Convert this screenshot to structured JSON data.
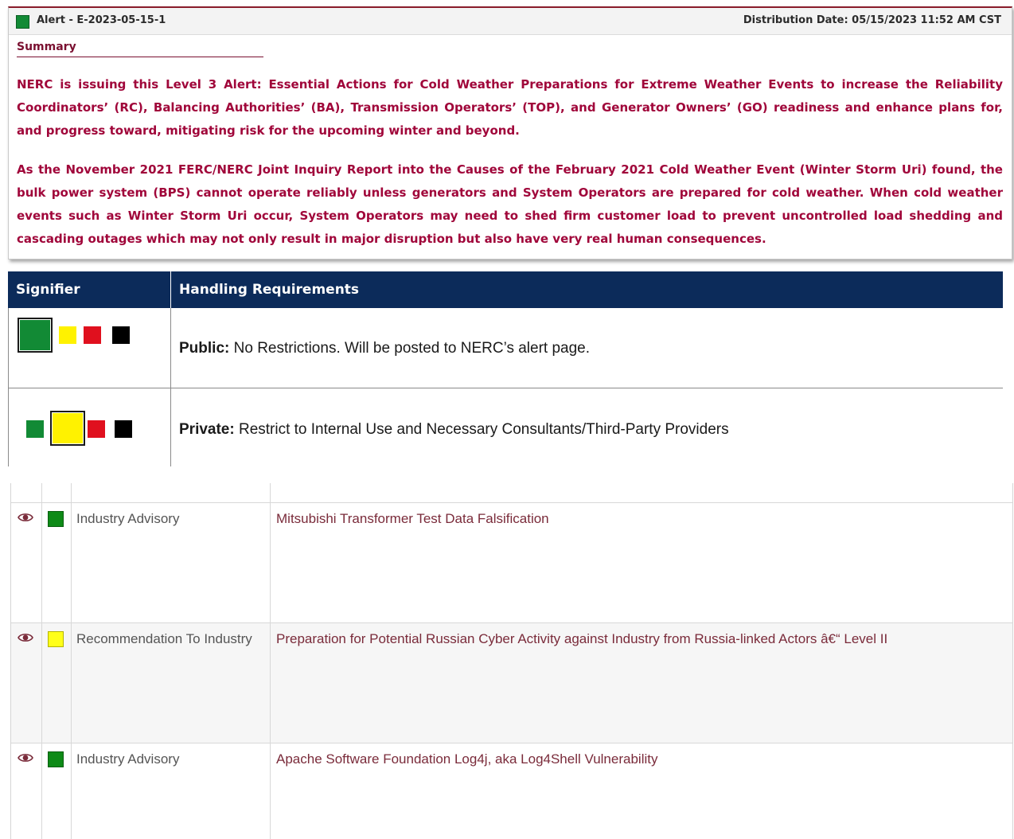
{
  "alert": {
    "id": "Alert - E-2023-05-15-1",
    "distribution": "Distribution Date: 05/15/2023 11:52 AM CST",
    "summary_label": "Summary",
    "paragraphs": [
      "NERC is issuing this Level 3 Alert: Essential Actions for Cold Weather Preparations for Extreme Weather Events to increase the Reliability Coordinators’ (RC), Balancing Authorities’ (BA), Transmission Operators’ (TOP), and Generator Owners’ (GO) readiness and enhance plans for, and progress toward, mitigating risk for the upcoming winter and beyond.",
      "As the November 2021 FERC/NERC Joint Inquiry Report  into the Causes of the February 2021 Cold Weather Event (Winter Storm Uri) found, the bulk power system (BPS) cannot operate reliably unless generators and System Operators are prepared for cold weather. When cold weather events such as Winter Storm Uri occur, System  Operators may need to shed firm customer load to prevent uncontrolled load shedding and cascading outages which may not only result in major disruption but also have very real human consequences."
    ],
    "signifier_color": "#128a35"
  },
  "signifier_table": {
    "headers": [
      "Signifier",
      "Handling Requirements"
    ],
    "rows": [
      {
        "label": "Public:",
        "text": " No Restrictions. Will be posted to NERC’s alert page.",
        "selected": "green"
      },
      {
        "label": "Private:",
        "text": " Restrict to Internal Use and Necessary Consultants/Third-Party Providers",
        "selected": "yellow"
      }
    ],
    "colors": {
      "green": "#128a35",
      "yellow": "#fff200",
      "red": "#e0101e",
      "black": "#000000",
      "header_bg": "#0c2b5a"
    }
  },
  "alerts_list": {
    "rows": [
      {
        "icon": "eye-icon",
        "signifier": "green",
        "type": "Industry Advisory",
        "title": "Mitsubishi Transformer Test Data Falsification"
      },
      {
        "icon": "eye-icon",
        "signifier": "yellow",
        "type": "Recommendation To Industry",
        "title": "Preparation for Potential Russian Cyber Activity against Industry from Russia-linked Actors â€“ Level II"
      },
      {
        "icon": "eye-icon",
        "signifier": "green",
        "type": "Industry Advisory",
        "title": "Apache Software Foundation Log4j, aka Log4Shell Vulnerability"
      }
    ]
  }
}
